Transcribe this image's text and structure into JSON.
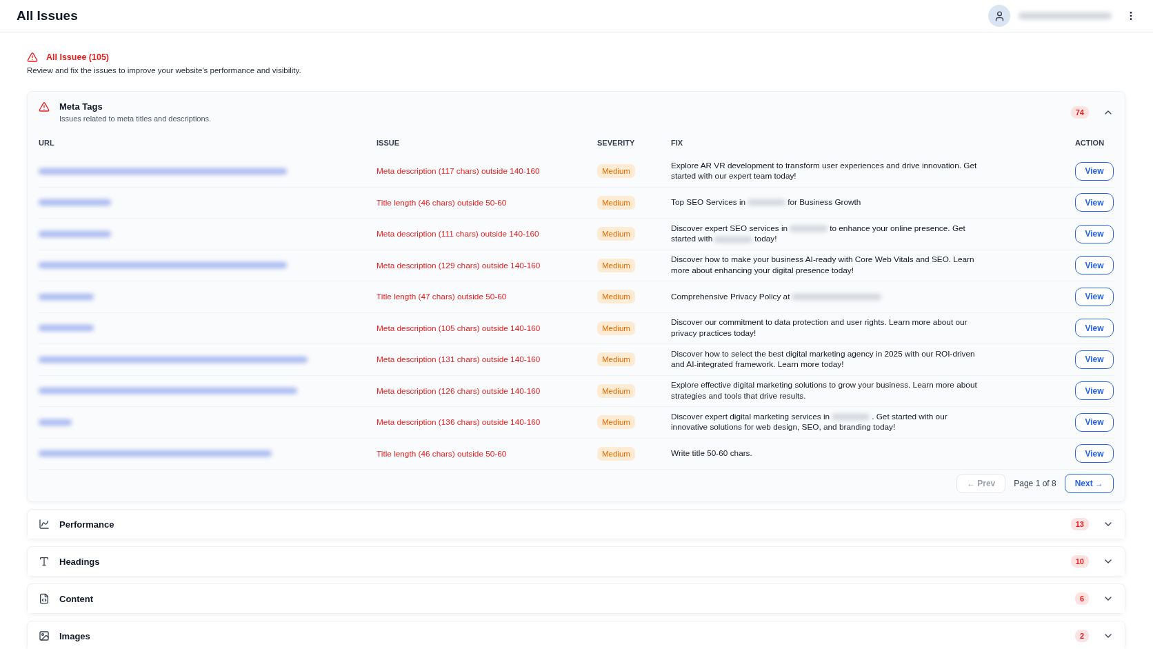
{
  "header": {
    "title": "All Issues"
  },
  "summary": {
    "title": "All Issuee (105)",
    "description": "Review and fix the issues to improve your website's performance and visibility."
  },
  "sections": [
    {
      "kind": "meta",
      "title": "Meta Tags",
      "subtitle": "Issues related to meta titles and descriptions.",
      "count": "74",
      "expanded": true,
      "table": {
        "columns": [
          "URL",
          "ISSUE",
          "SEVERITY",
          "FIX",
          "ACTION"
        ],
        "rows": [
          {
            "issue": "Meta description (117 chars) outside 140-160",
            "severity": "Medium",
            "fix": [
              "Explore AR VR development to transform user experiences and drive innovation. Get started with our expert team today!"
            ],
            "action": "View"
          },
          {
            "issue": "Title length (46 chars) outside 50-60",
            "severity": "Medium",
            "fix": [
              "Top SEO Services in",
              "for Business Growth"
            ],
            "action": "View"
          },
          {
            "issue": "Meta description (111 chars) outside 140-160",
            "severity": "Medium",
            "fix": [
              "Discover expert SEO services in",
              "to enhance your online presence. Get started with",
              "today!"
            ],
            "action": "View"
          },
          {
            "issue": "Meta description (129 chars) outside 140-160",
            "severity": "Medium",
            "fix": [
              "Discover how to make your business AI-ready with Core Web Vitals and SEO. Learn more about enhancing your digital presence today!"
            ],
            "action": "View"
          },
          {
            "issue": "Title length (47 chars) outside 50-60",
            "severity": "Medium",
            "fix": [
              "Comprehensive Privacy Policy at"
            ],
            "redacted_end": true,
            "action": "View"
          },
          {
            "issue": "Meta description (105 chars) outside 140-160",
            "severity": "Medium",
            "fix": [
              "Discover our commitment to data protection and user rights. Learn more about our privacy practices today!"
            ],
            "action": "View"
          },
          {
            "issue": "Meta description (131 chars) outside 140-160",
            "severity": "Medium",
            "fix": [
              "Discover how to select the best digital marketing agency in 2025 with our ROI-driven and AI-integrated framework. Learn more today!"
            ],
            "action": "View"
          },
          {
            "issue": "Meta description (126 chars) outside 140-160",
            "severity": "Medium",
            "fix": [
              "Explore effective digital marketing solutions to grow your business. Learn more about strategies and tools that drive results."
            ],
            "action": "View"
          },
          {
            "issue": "Meta description (136 chars) outside 140-160",
            "severity": "Medium",
            "fix": [
              "Discover expert digital marketing services in",
              ". Get started with our innovative solutions for web design, SEO, and branding today!"
            ],
            "action": "View"
          },
          {
            "issue": "Title length (46 chars) outside 50-60",
            "severity": "Medium",
            "fix": [
              "Write title 50-60 chars."
            ],
            "action": "View"
          }
        ]
      },
      "pagination": {
        "prev": "← Prev",
        "prev_disabled": true,
        "page": "Page 1 of 8",
        "next": "Next →"
      }
    },
    {
      "kind": "performance",
      "title": "Performance",
      "count": "13",
      "expanded": false
    },
    {
      "kind": "headings",
      "title": "Headings",
      "count": "10",
      "expanded": false
    },
    {
      "kind": "content",
      "title": "Content",
      "count": "6",
      "expanded": false
    },
    {
      "kind": "images",
      "title": "Images",
      "count": "2",
      "expanded": false
    }
  ]
}
